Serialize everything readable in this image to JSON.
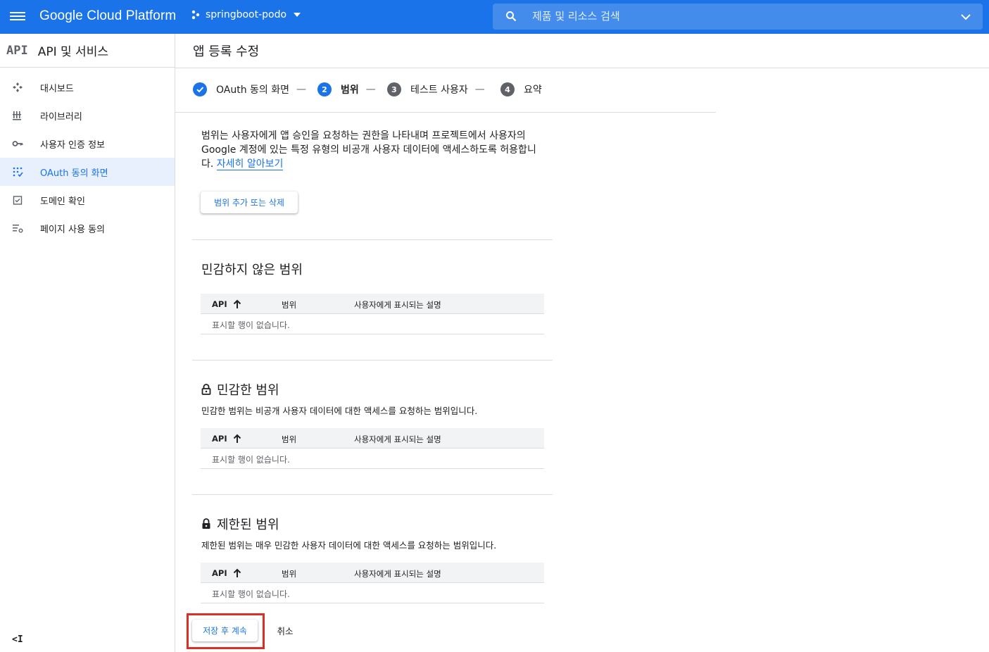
{
  "header": {
    "brand": "Google Cloud Platform",
    "project": "springboot-podo",
    "search_placeholder": "제품 및 리소스 검색"
  },
  "sidebar": {
    "logo": "API",
    "title": "API 및 서비스",
    "items": [
      {
        "label": "대시보드",
        "icon": "dashboard-icon"
      },
      {
        "label": "라이브러리",
        "icon": "library-icon"
      },
      {
        "label": "사용자 인증 정보",
        "icon": "key-icon"
      },
      {
        "label": "OAuth 동의 화면",
        "icon": "oauth-icon",
        "active": true
      },
      {
        "label": "도메인 확인",
        "icon": "domain-check-icon"
      },
      {
        "label": "페이지 사용 동의",
        "icon": "page-settings-icon"
      }
    ],
    "collapse_label": "<I"
  },
  "main": {
    "title": "앱 등록 수정",
    "steps": [
      {
        "num": "✓",
        "label": "OAuth 동의 화면",
        "state": "done"
      },
      {
        "num": "2",
        "label": "범위",
        "state": "current"
      },
      {
        "num": "3",
        "label": "테스트 사용자",
        "state": "pending"
      },
      {
        "num": "4",
        "label": "요약",
        "state": "pending"
      }
    ],
    "step_separator": "—",
    "description": "범위는 사용자에게 앱 승인을 요청하는 권한을 나타내며 프로젝트에서 사용자의 Google 계정에 있는 특정 유형의 비공개 사용자 데이터에 액세스하도록 허용합니다.",
    "learn_more": "자세히 알아보기",
    "add_scope_button": "범위 추가 또는 삭제",
    "table_headers": {
      "api": "API",
      "scope": "범위",
      "description": "사용자에게 표시되는 설명"
    },
    "empty_text": "표시할 행이 없습니다.",
    "sections": [
      {
        "title": "민감하지 않은 범위",
        "subtitle": ""
      },
      {
        "title": "민감한 범위",
        "subtitle": "민감한 범위는 비공개 사용자 데이터에 대한 액세스를 요청하는 범위입니다."
      },
      {
        "title": "제한된 범위",
        "subtitle": "제한된 범위는 매우 민감한 사용자 데이터에 대한 액세스를 요청하는 범위입니다."
      }
    ],
    "save_button": "저장 후 계속",
    "cancel_button": "취소"
  },
  "colors": {
    "primary": "#1a73e8",
    "highlight": "#d93025",
    "step_pending": "#5f6368"
  }
}
